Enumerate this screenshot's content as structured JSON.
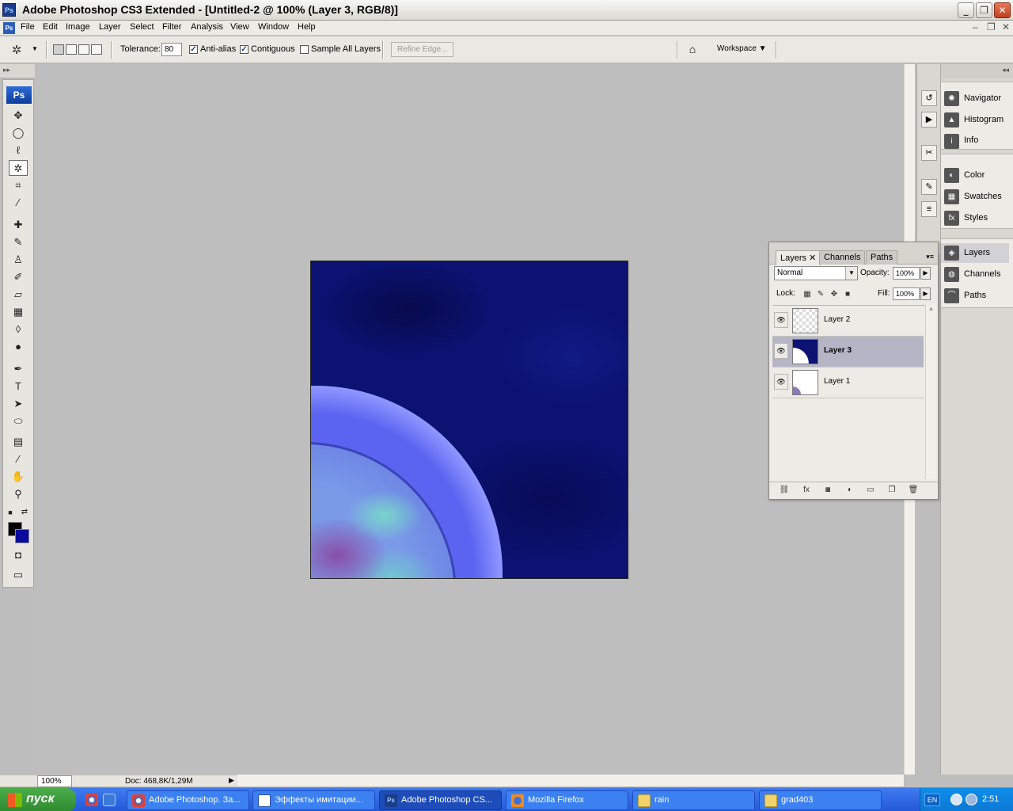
{
  "window": {
    "title": "Adobe Photoshop CS3 Extended - [Untitled-2 @ 100% (Layer 3, RGB/8)]",
    "app_icon": "Ps",
    "buttons": {
      "minimize": "_",
      "restore": "❐",
      "close": "✕"
    }
  },
  "menu": {
    "items": [
      "File",
      "Edit",
      "Image",
      "Layer",
      "Select",
      "Filter",
      "Analysis",
      "View",
      "Window",
      "Help"
    ],
    "doc_controls": {
      "minimize": "–",
      "restore": "❐",
      "close": "✕"
    }
  },
  "options": {
    "tolerance_label": "Tolerance:",
    "tolerance_value": "80",
    "antialias_label": "Anti-alias",
    "antialias_checked": true,
    "contiguous_label": "Contiguous",
    "contiguous_checked": true,
    "sample_all_label": "Sample All Layers",
    "sample_all_checked": false,
    "refine_edge_label": "Refine Edge...",
    "workspace_label": "Workspace ▼",
    "check_mark": "✓"
  },
  "tools": {
    "logo": "Ps",
    "colors": {
      "foreground": "#000000",
      "background": "#0a0a9c"
    }
  },
  "status": {
    "zoom": "100%",
    "doc_size": "Doc: 468,8K/1,29M"
  },
  "dock": {
    "panels_group1": [
      "Navigator",
      "Histogram",
      "Info"
    ],
    "panels_group2": [
      "Color",
      "Swatches",
      "Styles"
    ],
    "panels_group3": [
      "Layers",
      "Channels",
      "Paths"
    ]
  },
  "layers_panel": {
    "tabs": [
      "Layers",
      "Channels",
      "Paths"
    ],
    "blend_mode": "Normal",
    "opacity_label": "Opacity:",
    "opacity_value": "100%",
    "lock_label": "Lock:",
    "fill_label": "Fill:",
    "fill_value": "100%",
    "layers": [
      {
        "name": "Layer 2",
        "selected": false
      },
      {
        "name": "Layer 3",
        "selected": true
      },
      {
        "name": "Layer 1",
        "selected": false
      }
    ]
  },
  "taskbar": {
    "start_label": "пуск",
    "tasks": [
      {
        "label": "Adobe Photoshop. За...",
        "active": false
      },
      {
        "label": "Эффекты имитации...",
        "active": false
      },
      {
        "label": "Adobe Photoshop CS...",
        "active": true
      },
      {
        "label": "Mozilla Firefox",
        "active": false
      },
      {
        "label": "rain",
        "active": false
      },
      {
        "label": "grad403",
        "active": false
      }
    ],
    "language": "EN",
    "clock": "2:51"
  }
}
